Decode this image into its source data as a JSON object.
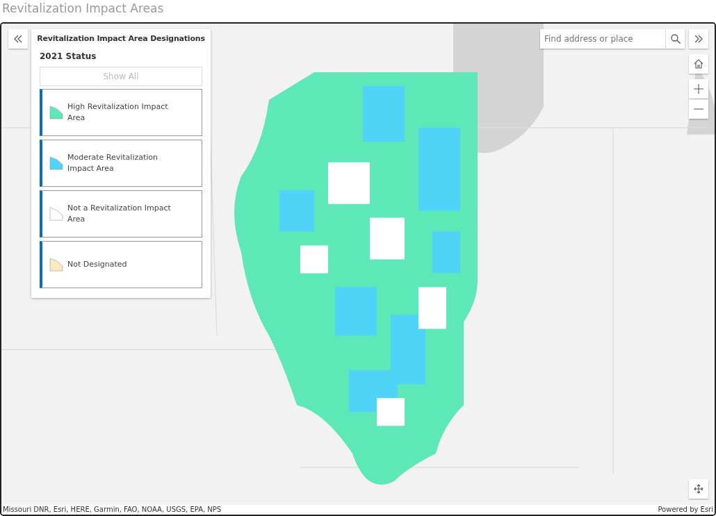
{
  "page_title": "Revitalization Impact Areas",
  "legend": {
    "title": "Revitalization Impact Area Designations",
    "subtitle": "2021 Status",
    "show_all": "Show All",
    "items": [
      {
        "label": "High Revitalization Impact Area",
        "color": "#5ee8b8"
      },
      {
        "label": "Moderate Revitalization Impact Area",
        "color": "#4fd3f7"
      },
      {
        "label": "Not a Revitalization Impact Area",
        "color": "#ffffff"
      },
      {
        "label": "Not Designated",
        "color": "#fde8c0"
      }
    ]
  },
  "search": {
    "placeholder": "Find address or place"
  },
  "attribution": "Missouri DNR, Esri, HERE, Garmin, FAO, NOAA, USGS, EPA, NPS",
  "powered_by": "Powered by Esri"
}
